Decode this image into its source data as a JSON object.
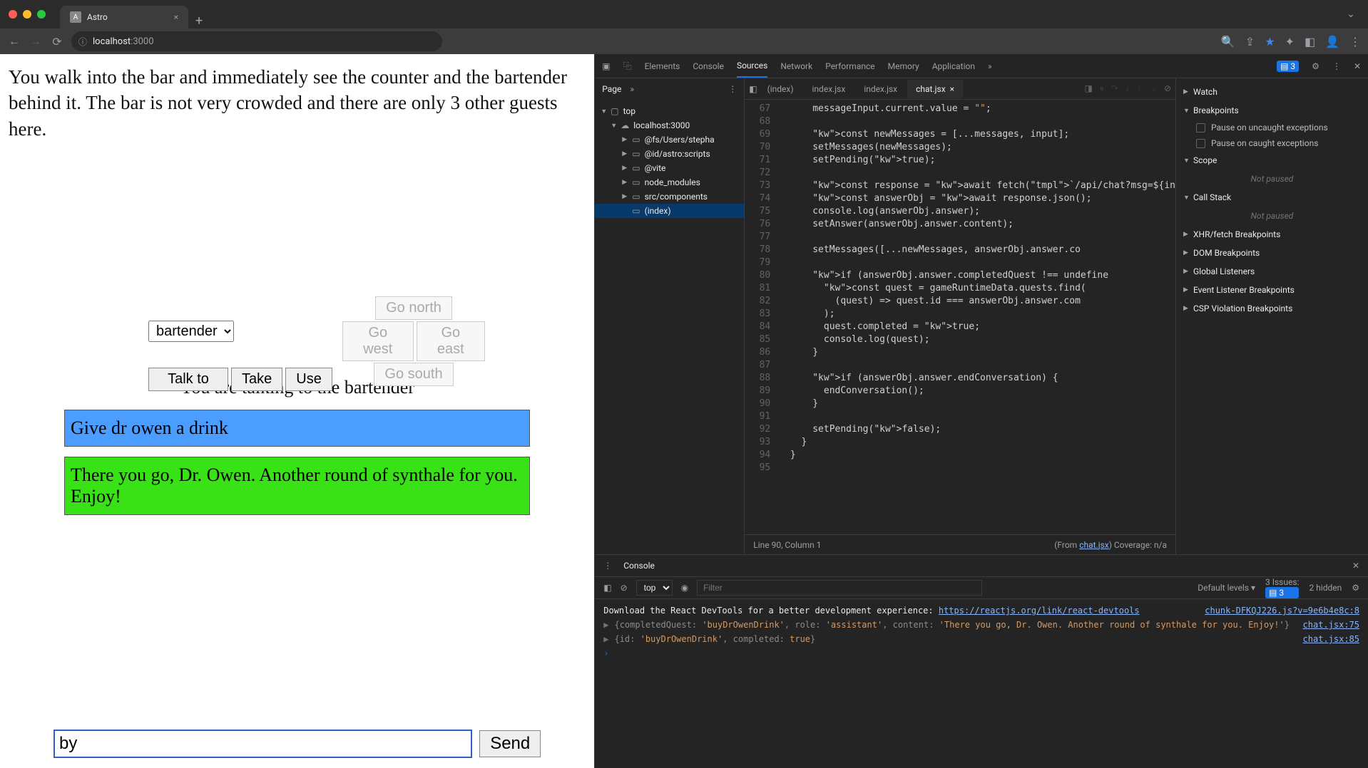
{
  "browser": {
    "tab_title": "Astro",
    "close_glyph": "×",
    "new_tab_glyph": "+",
    "tab_tail_glyph": "⌄",
    "nav": {
      "back": "←",
      "forward": "→",
      "reload": "⟳"
    },
    "addr_host": "localhost",
    "addr_port": ":3000"
  },
  "game": {
    "room_text": "You walk into the bar and immediately see the counter and the bartender behind it. The bar is not very crowded and there are only 3 other guests here.",
    "talk_to": "Talk to",
    "take": "Take",
    "use": "Use",
    "select_value": "bartender",
    "go_north": "Go north",
    "go_west": "Go west",
    "go_east": "Go east",
    "go_south": "Go south",
    "heading": "You are talking to the bartender",
    "messages": [
      {
        "role": "user",
        "text": "Give dr owen a drink"
      },
      {
        "role": "assistant",
        "text": "There you go, Dr. Owen. Another round of synthale for you. Enjoy!"
      }
    ],
    "input_value": "by",
    "send_label": "Send"
  },
  "devtools": {
    "tabs": [
      "Elements",
      "Console",
      "Sources",
      "Network",
      "Performance",
      "Memory",
      "Application"
    ],
    "active_tab": "Sources",
    "issues_count": "3",
    "page_label": "Page",
    "more_glyph": "»",
    "tree": {
      "top": "top",
      "host": "localhost:3000",
      "folders": [
        "@fs/Users/stepha",
        "@id/astro:scripts",
        "@vite",
        "node_modules",
        "src/components"
      ],
      "file": "(index)"
    },
    "editor_tabs": [
      "(index)",
      "index.jsx",
      "index.jsx",
      "chat.jsx"
    ],
    "active_editor_tab": "chat.jsx",
    "gutter": [
      "67",
      "68",
      "69",
      "70",
      "71",
      "72",
      "73",
      "74",
      "75",
      "76",
      "77",
      "78",
      "79",
      "80",
      "81",
      "82",
      "83",
      "84",
      "85",
      "86",
      "87",
      "88",
      "89",
      "90",
      "91",
      "92",
      "93",
      "94",
      "95"
    ],
    "code_lines": [
      "      messageInput.current.value = \"\";",
      "",
      "      const newMessages = [...messages, input];",
      "      setMessages(newMessages);",
      "      setPending(true);",
      "",
      "      const response = await fetch(`/api/chat?msg=${in",
      "      const answerObj = await response.json();",
      "      console.log(answerObj.answer);",
      "      setAnswer(answerObj.answer.content);",
      "",
      "      setMessages([...newMessages, answerObj.answer.co",
      "",
      "      if (answerObj.answer.completedQuest !== undefine",
      "        const quest = gameRuntimeData.quests.find(",
      "          (quest) => quest.id === answerObj.answer.com",
      "        );",
      "        quest.completed = true;",
      "        console.log(quest);",
      "      }",
      "",
      "      if (answerObj.answer.endConversation) {",
      "        endConversation();",
      "      }",
      "",
      "      setPending(false);",
      "    }",
      "  }",
      ""
    ],
    "status_line": "Line 90, Column 1",
    "status_from": "(From ",
    "status_file": "chat.jsx",
    "status_tail": ") Coverage: n/a",
    "side": {
      "watch": "Watch",
      "breakpoints": "Breakpoints",
      "bp1": "Pause on uncaught exceptions",
      "bp2": "Pause on caught exceptions",
      "scope": "Scope",
      "not_paused": "Not paused",
      "callstack": "Call Stack",
      "xhr": "XHR/fetch Breakpoints",
      "dom": "DOM Breakpoints",
      "global": "Global Listeners",
      "evt": "Event Listener Breakpoints",
      "csp": "CSP Violation Breakpoints"
    },
    "console": {
      "tab": "Console",
      "scope": "top",
      "filter_placeholder": "Filter",
      "levels": "Default levels",
      "issues_label": "3 Issues:",
      "issues_num": "3",
      "hidden": "2 hidden",
      "chunk_src": "chunk-DFKQJ226.js?v=9e6b4e8c:8",
      "react_msg_a": "Download the React DevTools for a better development experience: ",
      "react_link": "https://reactjs.org/link/react-devtools",
      "log1_src": "chat.jsx:75",
      "log1": "{completedQuest: 'buyDrOwenDrink', role: 'assistant', content: 'There you go, Dr. Owen. Another round of synthale for you. Enjoy!'}",
      "log2_src": "chat.jsx:85",
      "log2": "{id: 'buyDrOwenDrink', completed: true}"
    }
  }
}
